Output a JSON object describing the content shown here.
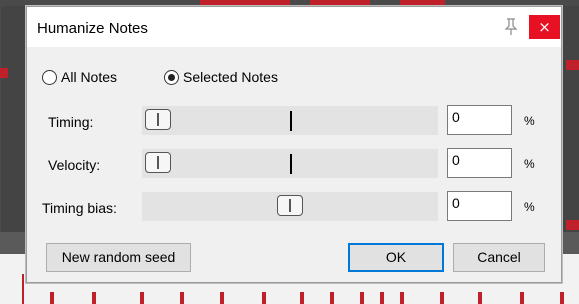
{
  "dialog": {
    "title": "Humanize Notes",
    "close_glyph": "×",
    "pin_icon": "pin-icon"
  },
  "mode": {
    "options": [
      {
        "label": "All Notes",
        "selected": false
      },
      {
        "label": "Selected Notes",
        "selected": true
      }
    ]
  },
  "params": [
    {
      "label": "Timing:",
      "value": "0",
      "unit": "%",
      "slider_level": 0.0
    },
    {
      "label": "Velocity:",
      "value": "0",
      "unit": "%",
      "slider_level": 0.0
    },
    {
      "label": "Timing bias:",
      "value": "0",
      "unit": "%",
      "slider_level": 0.5
    }
  ],
  "buttons": {
    "new_seed": "New random seed",
    "ok": "OK",
    "cancel": "Cancel"
  },
  "colors": {
    "close": "#e81123",
    "accent": "#0078d7",
    "note": "#c0202a"
  }
}
